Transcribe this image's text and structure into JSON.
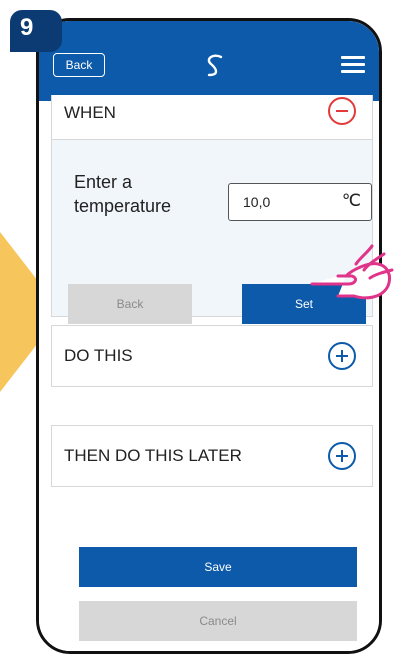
{
  "step": {
    "number": "9"
  },
  "header": {
    "back_label": "Back",
    "logo": "salus-logo-icon",
    "menu_icon": "hamburger-menu-icon"
  },
  "when": {
    "label": "WHEN",
    "collapse_icon": "minus-circle-icon"
  },
  "temperature": {
    "label_line1": "Enter a",
    "label_line2": "temperature",
    "value": "10,0",
    "unit": "℃"
  },
  "panel_buttons": {
    "back_label": "Back",
    "set_label": "Set"
  },
  "do_this": {
    "label": "DO THIS",
    "expand_icon": "plus-circle-icon"
  },
  "then_do_this_later": {
    "label": "THEN DO THIS LATER",
    "expand_icon": "plus-circle-icon"
  },
  "footer": {
    "save_label": "Save",
    "cancel_label": "Cancel"
  },
  "colors": {
    "primary": "#0c5aa9",
    "badge": "#0c3b73",
    "remove": "#e23a3a",
    "disabled": "#d7d7d7",
    "highlight": "#e0338a",
    "arrow": "#f6c65c"
  }
}
